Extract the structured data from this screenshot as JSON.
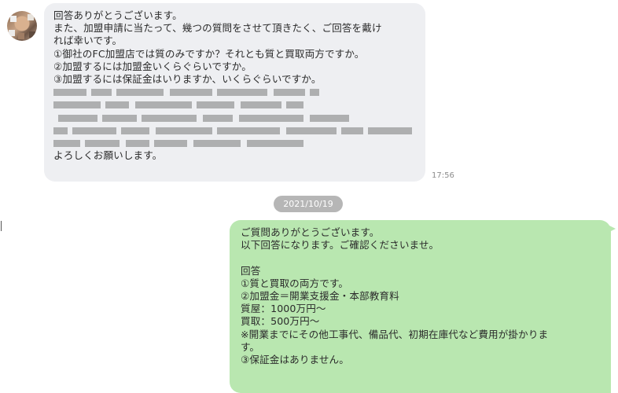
{
  "received_message": {
    "lines": [
      "回答ありがとうございます。",
      "また、加盟申請に当たって、幾つの質問をさせて頂きたく、ご回答を戴け",
      "れば幸いです。",
      "①御社のFC加盟店では質のみですか？それとも質と買取両方ですか。",
      "②加盟するには加盟金いくらぐらいですか。",
      "③加盟するには保証金はいりますか、いくらぐらいですか。"
    ],
    "closing": "よろしくお願いします。",
    "time": "17:56"
  },
  "date_separator": "2021/10/19",
  "sent_message": {
    "lines": [
      "ご質問ありがとうございます。",
      "以下回答になります。ご確認くださいませ。",
      "",
      "回答",
      "①質と買取の両方です。",
      "②加盟金＝開業支援金・本部教育料",
      "質屋：1000万円〜",
      "買取：500万円〜",
      "※開業までにその他工事代、備品代、初期在庫代など費用が掛かりま",
      "す。",
      "③保証金はありません。"
    ]
  },
  "colors": {
    "received_bubble": "#eeeff2",
    "sent_bubble": "#b9e7b0",
    "date_pill": "#b6b6b6"
  }
}
